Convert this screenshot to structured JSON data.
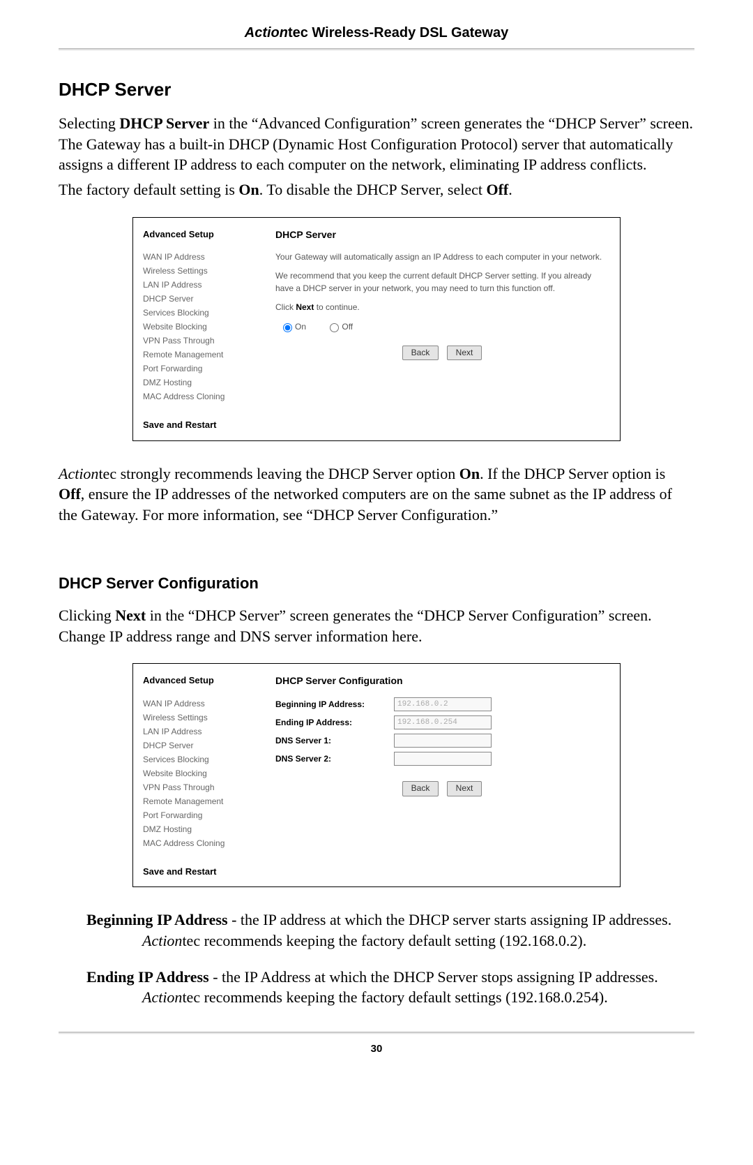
{
  "header": {
    "brand_italic": "Action",
    "brand_rest": "tec Wireless-Ready DSL Gateway"
  },
  "section1": {
    "title": "DHCP Server",
    "para_html": "Selecting <b>DHCP Server</b> in the “Advanced Configuration” screen generates the “DHCP Server” screen. The Gateway has a built-in DHCP (Dynamic Host Configuration Protocol) server that automatically assigns a different IP address to each computer on the network, eliminating IP address conflicts.",
    "para2_html": "The factory default setting is <b>On</b>. To disable the DHCP Server, select <b>Off</b>."
  },
  "sidebar": {
    "title": "Advanced Setup",
    "items": [
      "WAN IP Address",
      "Wireless Settings",
      "LAN IP Address",
      "DHCP Server",
      "Services Blocking",
      "Website Blocking",
      "VPN Pass Through",
      "Remote Management",
      "Port Forwarding",
      "DMZ Hosting",
      "MAC Address Cloning"
    ],
    "save": "Save and Restart"
  },
  "panel1": {
    "title": "DHCP Server",
    "text1": "Your Gateway will automatically assign an IP Address to each computer in your network.",
    "text2": "We recommend that you keep the current default DHCP Server setting. If you already have a DHCP server in your network, you may need to turn this function off.",
    "text3_html": "Click <b>Next</b> to continue.",
    "radio_on": "On",
    "radio_off": "Off",
    "back": "Back",
    "next": "Next"
  },
  "after1_html": "<span class=\"italic-inline\">Action</span>tec strongly recommends leaving the DHCP Server option <b>On</b>.  If the DHCP Server option is <b>Off</b>, ensure the IP addresses of the networked computers are on the same subnet as the IP address of the Gateway. For more information, see “DHCP Server Configuration.”",
  "section2": {
    "title": "DHCP Server Configuration",
    "para_html": "Clicking <b>Next</b> in the “DHCP Server” screen generates the “DHCP Server Configuration” screen. Change IP address range and DNS server information here."
  },
  "panel2": {
    "title": "DHCP Server Configuration",
    "fields": {
      "begin_label": "Beginning IP Address:",
      "begin_value": "192.168.0.2",
      "end_label": "Ending IP Address:",
      "end_value": "192.168.0.254",
      "dns1_label": "DNS Server 1:",
      "dns1_value": "",
      "dns2_label": "DNS Server 2:",
      "dns2_value": ""
    },
    "back": "Back",
    "next": "Next"
  },
  "defs": {
    "begin_html": "<span class=\"def-term\">Beginning IP Address</span> - the IP address at which the DHCP server starts assigning IP addresses. <span class=\"italic-inline\">Action</span>tec recommends keeping the factory default setting (192.168.0.2).",
    "end_html": "<span class=\"def-term\">Ending IP Address</span> - the IP Address at which the DHCP Server stops assigning IP addresses. <span class=\"italic-inline\">Action</span>tec recommends keeping the facto­ry default settings (192.168.0.254)."
  },
  "page_number": "30"
}
